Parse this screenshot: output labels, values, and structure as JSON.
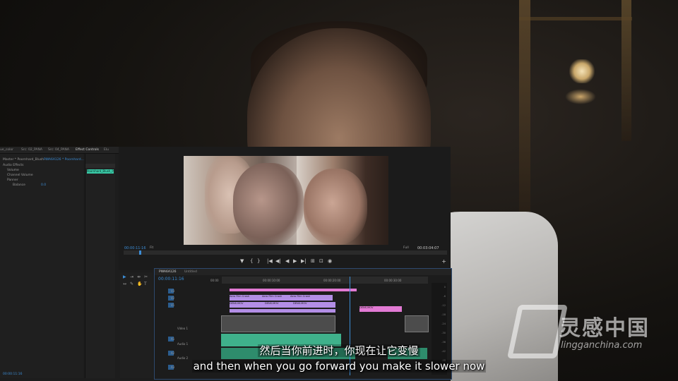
{
  "tabs": {
    "source_items": [
      "ue_color",
      "Src: 02_PANA",
      "Src: 04_PANA",
      "Effect Controls",
      "Elu"
    ],
    "program_label": "Program: PWA6A126",
    "reference_label": "Source: (no clips)"
  },
  "effect_controls": {
    "master": "Master * Poornhard_Blush...",
    "sequence": "PWA6A126 * Poornhard...",
    "rows": [
      "Audio Effects",
      "Volume",
      "Channel Volume",
      "Panner",
      "Balance"
    ],
    "balance_value": "0.0"
  },
  "mini_timeline": {
    "clip_label": "Poornhard_Blush_Pro"
  },
  "program_monitor": {
    "current_time": "00:00:11:16",
    "fit": "Full",
    "duration": "00:03:04:07",
    "left_fit": "Fit"
  },
  "transport": [
    "▼",
    "{",
    "}",
    "|◀",
    "◀|",
    "◀",
    "▶",
    "▶|",
    "⊞",
    "⊡",
    "◉"
  ],
  "timeline": {
    "tabs": [
      "PWA6A126",
      "Untitled"
    ],
    "timecode": "00:00:11:16",
    "ruler_labels": [
      "00:00",
      "00:00:10:00",
      "00:00:20:00",
      "00:00:30:00"
    ],
    "video_tracks": [
      "V3",
      "V2",
      "V1"
    ],
    "audio_tracks": [
      "A1",
      "A2",
      "A3"
    ],
    "v1_label": "Video 1",
    "a1_label": "Audio 1",
    "a2_label": "Audio 2",
    "clips_v3": [
      "Aero Film Crash",
      "Aero Film Crash",
      "Aero Film Crash"
    ],
    "clips_v2": [
      "DENS.MOV",
      "DENS.MOV",
      "DENS.MOV",
      "DENS.MOV"
    ],
    "meter_labels": [
      "0",
      "-6",
      "-12",
      "-18",
      "-24",
      "-30",
      "-36",
      "-42",
      "-48",
      "dB"
    ]
  },
  "status": "00:00:11:16",
  "subtitles": {
    "chinese": "然后当你前进时，你现在让它变慢",
    "english": "and then when you go forward you make it slower now"
  },
  "watermark": {
    "chinese": "灵感中国",
    "english": "lingganchina.com"
  }
}
